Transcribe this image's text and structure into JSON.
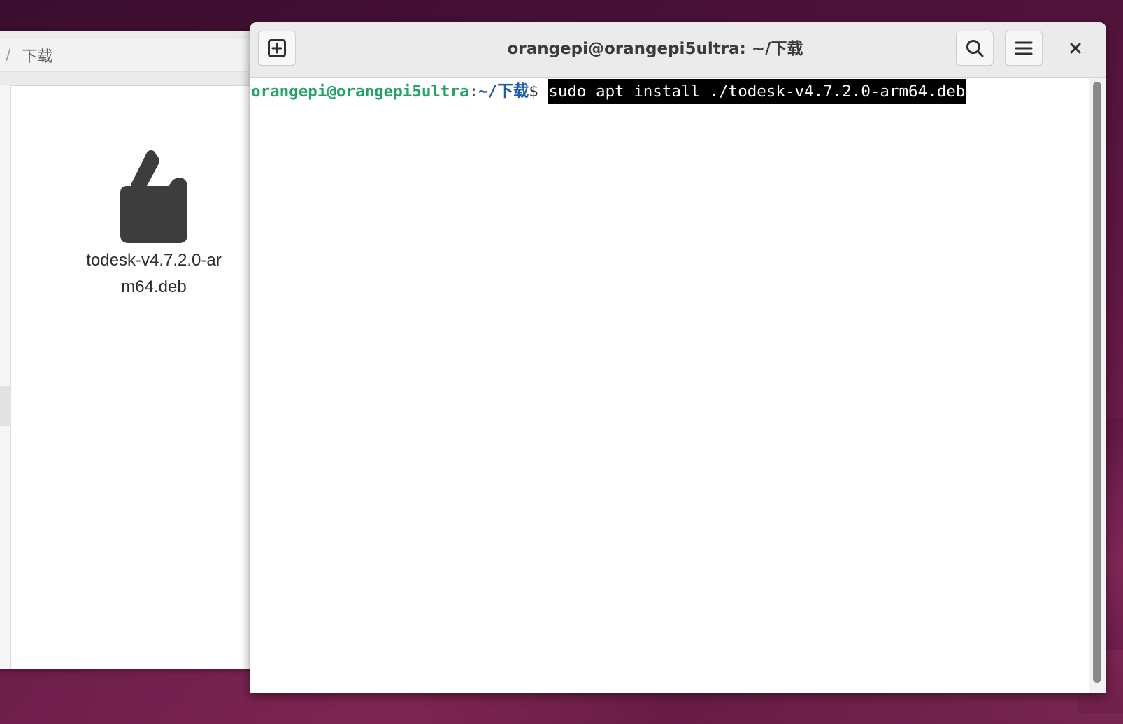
{
  "file_manager": {
    "path_separator": "/",
    "path_current": "下载",
    "file": {
      "name": "todesk-v4.7.2.0-arm64.deb",
      "icon": "package-icon"
    }
  },
  "terminal": {
    "title": "orangepi@orangepi5ultra: ~/下载",
    "buttons": {
      "new_tab_icon": "new-tab-icon",
      "search_icon": "search-icon",
      "menu_icon": "hamburger-menu-icon",
      "close_icon": "close-icon"
    },
    "prompt": {
      "user_host": "orangepi@orangepi5ultra",
      "colon": ":",
      "path": "~/下载",
      "symbol": "$ ",
      "command": "sudo apt install ./todesk-v4.7.2.0-arm64.deb"
    }
  },
  "colors": {
    "prompt_user": "#26a269",
    "prompt_path": "#1c5ca8",
    "selection_bg": "#000000",
    "selection_fg": "#ffffff"
  }
}
